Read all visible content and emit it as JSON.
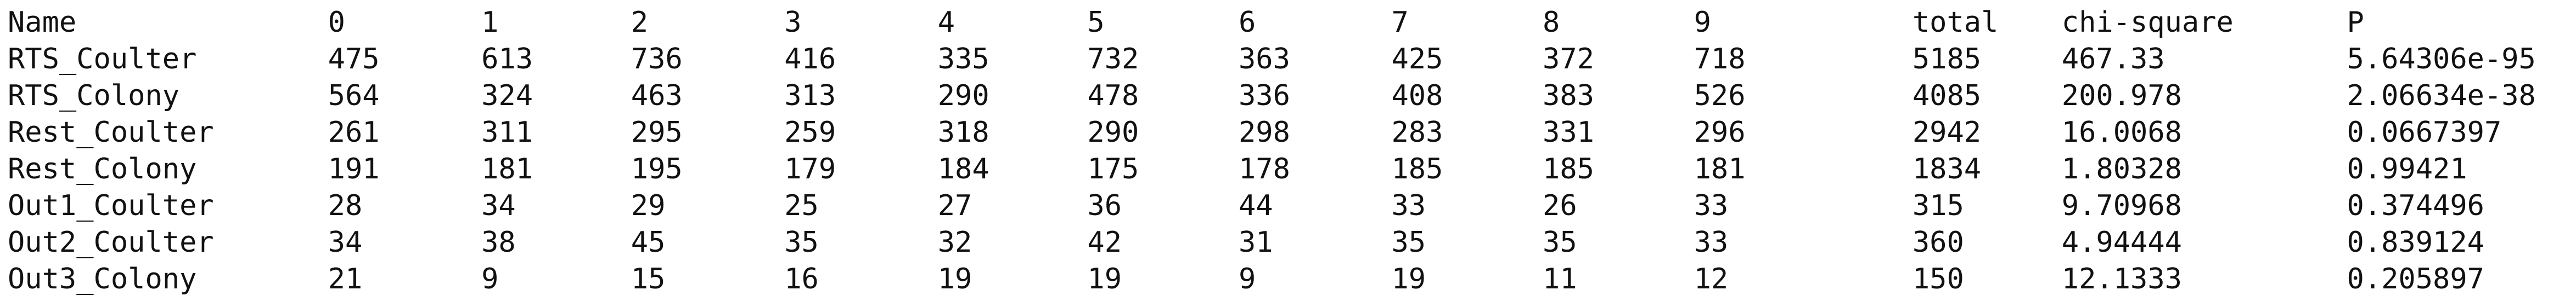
{
  "table": {
    "headers": [
      "Name",
      "0",
      "1",
      "2",
      "3",
      "4",
      "5",
      "6",
      "7",
      "8",
      "9",
      "total",
      "chi-square",
      "P"
    ],
    "rows": [
      [
        "RTS_Coulter",
        "475",
        "613",
        "736",
        "416",
        "335",
        "732",
        "363",
        "425",
        "372",
        "718",
        "5185",
        "467.33",
        "5.64306e-95"
      ],
      [
        "RTS_Colony",
        "564",
        "324",
        "463",
        "313",
        "290",
        "478",
        "336",
        "408",
        "383",
        "526",
        "4085",
        "200.978",
        "2.06634e-38"
      ],
      [
        "Rest_Coulter",
        "261",
        "311",
        "295",
        "259",
        "318",
        "290",
        "298",
        "283",
        "331",
        "296",
        "2942",
        "16.0068",
        "0.0667397"
      ],
      [
        "Rest_Colony",
        "191",
        "181",
        "195",
        "179",
        "184",
        "175",
        "178",
        "185",
        "185",
        "181",
        "1834",
        "1.80328",
        "0.99421"
      ],
      [
        "Out1_Coulter",
        "28",
        "34",
        "29",
        "25",
        "27",
        "36",
        "44",
        "33",
        "26",
        "33",
        "315",
        "9.70968",
        "0.374496"
      ],
      [
        "Out2_Coulter",
        "34",
        "38",
        "45",
        "35",
        "32",
        "42",
        "31",
        "35",
        "35",
        "33",
        "360",
        "4.94444",
        "0.839124"
      ],
      [
        "Out3_Colony",
        "21",
        "9",
        "15",
        "16",
        "19",
        "19",
        "9",
        "19",
        "11",
        "12",
        "150",
        "12.1333",
        "0.205897"
      ]
    ]
  }
}
